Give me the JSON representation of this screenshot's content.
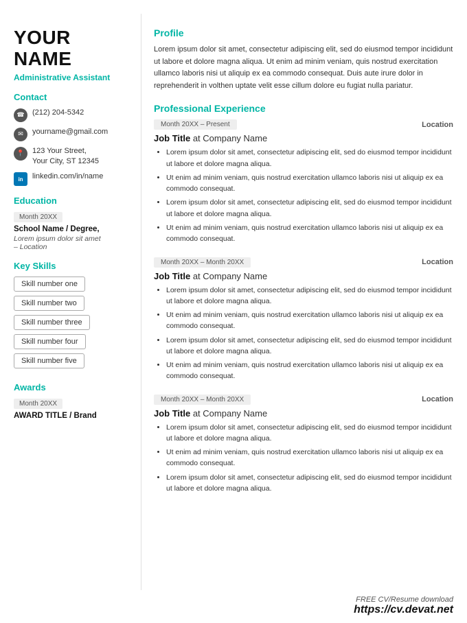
{
  "sidebar": {
    "name_line1": "YOUR",
    "name_line2": "NAME",
    "job_title": "Administrative Assistant",
    "contact_label": "Contact",
    "contact_items": [
      {
        "type": "phone",
        "icon": "☎",
        "text": "(212) 204-5342"
      },
      {
        "type": "email",
        "icon": "✉",
        "text": "yourname@gmail.com"
      },
      {
        "type": "address",
        "icon": "📍",
        "text": "123 Your Street,\nYour City, ST 12345"
      },
      {
        "type": "linkedin",
        "icon": "in",
        "text": "linkedin.com/in/name"
      }
    ],
    "education_label": "Education",
    "education": [
      {
        "date": "Month 20XX",
        "school": "School Name / Degree,",
        "detail": "Lorem ipsum dolor sit amet\n– Location"
      }
    ],
    "skills_label": "Key Skills",
    "skills": [
      "Skill number one",
      "Skill number two",
      "Skill number three",
      "Skill number four",
      "Skill number five"
    ],
    "awards_label": "Awards",
    "awards": [
      {
        "date": "Month 20XX",
        "title": "AWARD TITLE / Brand"
      }
    ]
  },
  "main": {
    "profile_label": "Profile",
    "profile_text": "Lorem ipsum dolor sit amet, consectetur adipiscing elit, sed do eiusmod tempor incididunt ut labore et dolore magna aliqua. Ut enim ad minim veniam, quis nostrud exercitation ullamco laboris nisi ut aliquip ex ea commodo consequat. Duis aute irure dolor in reprehenderit in volthen uptate velit esse cillum dolore eu fugiat nulla pariatur.",
    "experience_label": "Professional Experience",
    "experiences": [
      {
        "date": "Month 20XX – Present",
        "location": "Location",
        "job_title": "Job Title",
        "company": "at Company Name",
        "bullets": [
          "Lorem ipsum dolor sit amet, consectetur adipiscing elit, sed do eiusmod tempor incididunt ut labore et dolore magna aliqua.",
          "Ut enim ad minim veniam, quis nostrud exercitation ullamco laboris nisi ut aliquip ex ea commodo consequat.",
          "Lorem ipsum dolor sit amet, consectetur adipiscing elit, sed do eiusmod tempor incididunt ut labore et dolore magna aliqua.",
          "Ut enim ad minim veniam, quis nostrud exercitation ullamco laboris nisi ut aliquip ex ea commodo consequat."
        ]
      },
      {
        "date": "Month 20XX – Month 20XX",
        "location": "Location",
        "job_title": "Job Title",
        "company": "at Company Name",
        "bullets": [
          "Lorem ipsum dolor sit amet, consectetur adipiscing elit, sed do eiusmod tempor incididunt ut labore et dolore magna aliqua.",
          "Ut enim ad minim veniam, quis nostrud exercitation ullamco laboris nisi ut aliquip ex ea commodo consequat.",
          "Lorem ipsum dolor sit amet, consectetur adipiscing elit, sed do eiusmod tempor incididunt ut labore et dolore magna aliqua.",
          "Ut enim ad minim veniam, quis nostrud exercitation ullamco laboris nisi ut aliquip ex ea commodo consequat."
        ]
      },
      {
        "date": "Month 20XX – Month 20XX",
        "location": "Location",
        "job_title": "Job Title",
        "company": "at Company Name",
        "bullets": [
          "Lorem ipsum dolor sit amet, consectetur adipiscing elit, sed do eiusmod tempor incididunt ut labore et dolore magna aliqua.",
          "Ut enim ad minim veniam, quis nostrud exercitation ullamco laboris nisi ut aliquip ex ea commodo consequat.",
          "Lorem ipsum dolor sit amet, consectetur adipiscing elit, sed do eiusmod tempor incididunt ut labore et dolore magna aliqua."
        ]
      }
    ]
  },
  "footer": {
    "free_text": "FREE CV/Resume download",
    "url_text": "https://cv.devat.net"
  }
}
